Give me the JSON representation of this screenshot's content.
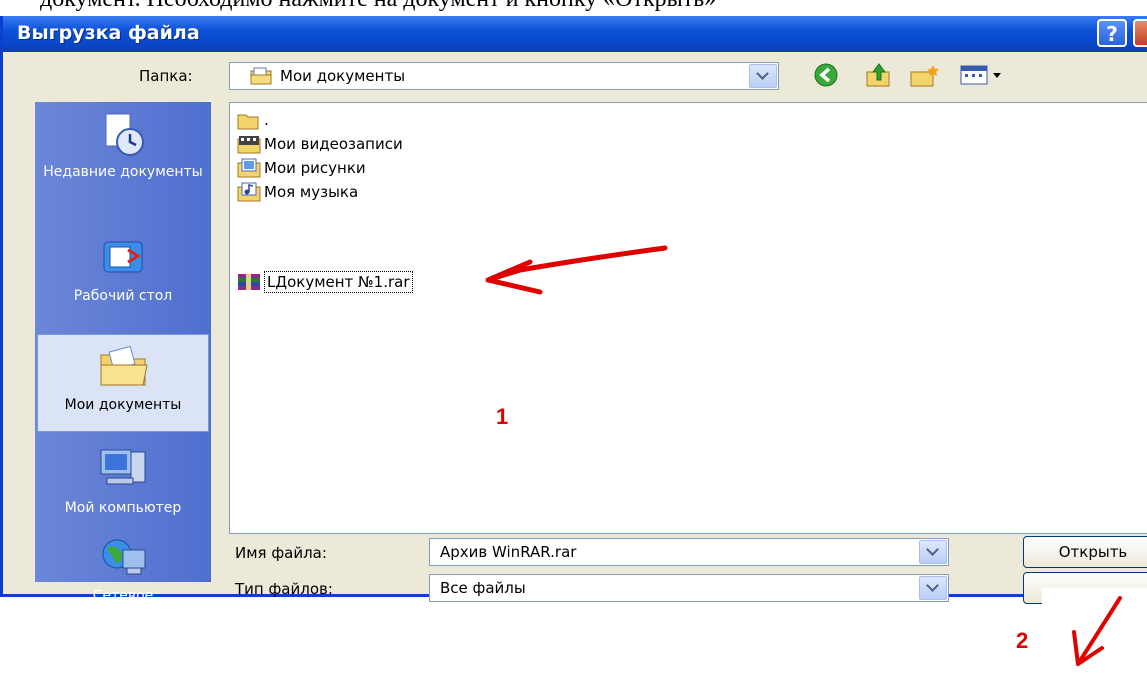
{
  "header_text": "документ. Необходимо нажмите на документ и кнопку «Открыть»",
  "window": {
    "title": "Выгрузка файла",
    "help_label": "?"
  },
  "folder_label": "Папка:",
  "folder_value": "Мои документы",
  "places": [
    {
      "label": "Недавние документы",
      "icon": "recent-documents-icon"
    },
    {
      "label": "Рабочий стол",
      "icon": "desktop-icon"
    },
    {
      "label": "Мои документы",
      "icon": "my-documents-icon"
    },
    {
      "label": "Мой компьютер",
      "icon": "my-computer-icon"
    },
    {
      "label": "Сетевое",
      "icon": "network-icon"
    }
  ],
  "files": [
    {
      "name": ".",
      "icon": "folder-icon"
    },
    {
      "name": "Мои видеозаписи",
      "icon": "video-folder-icon"
    },
    {
      "name": "Мои рисунки",
      "icon": "pictures-folder-icon"
    },
    {
      "name": "Моя музыка",
      "icon": "music-folder-icon"
    },
    {
      "name": "LДокумент №1.rar",
      "icon": "rar-archive-icon",
      "selected": true
    }
  ],
  "filename_label": "Имя файла:",
  "filename_value": "Архив WinRAR.rar",
  "filetype_label": "Тип файлов:",
  "filetype_value": "Все файлы",
  "open_button": "Открыть",
  "annotations": {
    "one": "1",
    "two": "2"
  },
  "colors": {
    "title_bar": "#0a46c8",
    "annotation": "#e00000",
    "dialog_bg": "#ece9d8"
  }
}
